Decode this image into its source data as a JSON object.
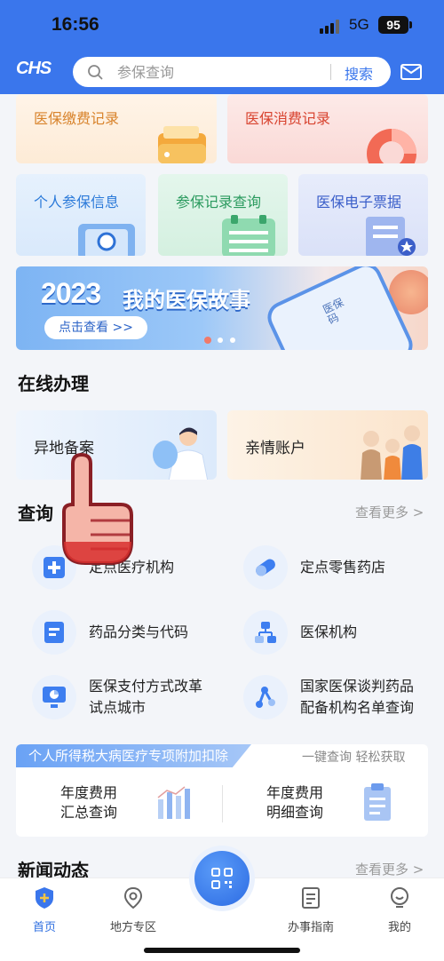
{
  "status_bar": {
    "time": "16:56",
    "network": "5G",
    "battery": "95"
  },
  "header": {
    "logo": "CHS",
    "search_placeholder": "参保查询",
    "search_button": "搜索",
    "mail_icon": "mail-icon"
  },
  "top_cards": [
    {
      "label": "医保缴费记录",
      "icon": "wallet-icon"
    },
    {
      "label": "医保消费记录",
      "icon": "pie-chart-icon"
    },
    {
      "label": "个人参保信息",
      "icon": "user-search-icon"
    },
    {
      "label": "参保记录查询",
      "icon": "clipboard-icon"
    },
    {
      "label": "医保电子票据",
      "icon": "receipt-icon"
    }
  ],
  "banner": {
    "year": "2023",
    "title": "我的医保故事",
    "button": "点击查看 >>",
    "phone_text": "医保码"
  },
  "online_section": {
    "title": "在线办理",
    "items": [
      {
        "label": "异地备案"
      },
      {
        "label": "亲情账户"
      }
    ]
  },
  "query_section": {
    "title": "查询",
    "more": "查看更多 >",
    "items": [
      {
        "label": "定点医疗机构",
        "icon": "hospital-icon"
      },
      {
        "label": "定点零售药店",
        "icon": "pill-icon"
      },
      {
        "label": "药品分类与代码",
        "icon": "document-icon"
      },
      {
        "label": "医保机构",
        "icon": "org-chart-icon"
      },
      {
        "label": "医保支付方式改革\n试点城市",
        "line1": "医保支付方式改革",
        "line2": "试点城市",
        "icon": "monitor-chart-icon"
      },
      {
        "label": "国家医保谈判药品\n配备机构名单查询",
        "line1": "国家医保谈判药品",
        "line2": "配备机构名单查询",
        "icon": "network-icon"
      }
    ]
  },
  "tax_section": {
    "tag": "个人所得税大病医疗专项附加扣除",
    "subtitle": "一键查询 轻松获取",
    "items": [
      {
        "line1": "年度费用",
        "line2": "汇总查询"
      },
      {
        "line1": "年度费用",
        "line2": "明细查询"
      }
    ]
  },
  "news_section": {
    "title": "新闻动态",
    "more": "查看更多 >"
  },
  "bottom_nav": {
    "items": [
      {
        "label": "首页",
        "icon": "home-shield-icon",
        "active": true
      },
      {
        "label": "地方专区",
        "icon": "location-pin-icon"
      },
      {
        "label": "办事指南",
        "icon": "guide-doc-icon"
      },
      {
        "label": "我的",
        "icon": "profile-icon"
      }
    ],
    "center": "qr-scan-icon"
  },
  "colors": {
    "primary": "#3a76ec",
    "text_blue": "#2b7ad9",
    "text_orange": "#d8832b",
    "text_red": "#d8432f",
    "text_green": "#2a9a5e"
  }
}
